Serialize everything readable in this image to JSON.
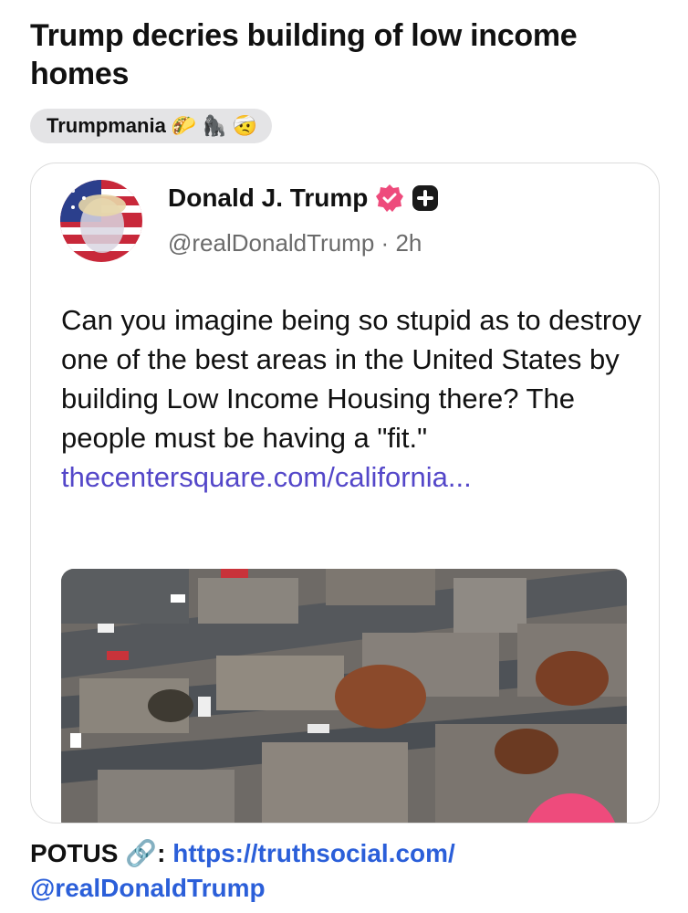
{
  "header": {
    "title": "Trump decries building of low income homes"
  },
  "category_chip": {
    "label": "Trumpmania",
    "emojis": [
      "🌮",
      "🦍",
      "🤕"
    ]
  },
  "post": {
    "author_name": "Donald J. Trump",
    "handle": "@realDonaldTrump",
    "separator": "·",
    "time": "2h",
    "text": "Can you imagine being so stupid as to destroy one of the best areas in the United States by building Low Income Housing there? The people must be having a \"fit.\" ",
    "link_text": "thecentersquare.com/california...",
    "icons": [
      "verified-badge-icon",
      "plus-badge-icon"
    ]
  },
  "footer": {
    "label": "POTUS",
    "link_emoji": "🔗",
    "colon": ":",
    "url_line1": "https://truthsocial.com/",
    "url_line2": "@realDonaldTrump"
  },
  "colors": {
    "link": "#5447c9",
    "footer_link": "#2b5fd9",
    "verified": "#ee4b7c",
    "fab": "#ee4b7c"
  }
}
